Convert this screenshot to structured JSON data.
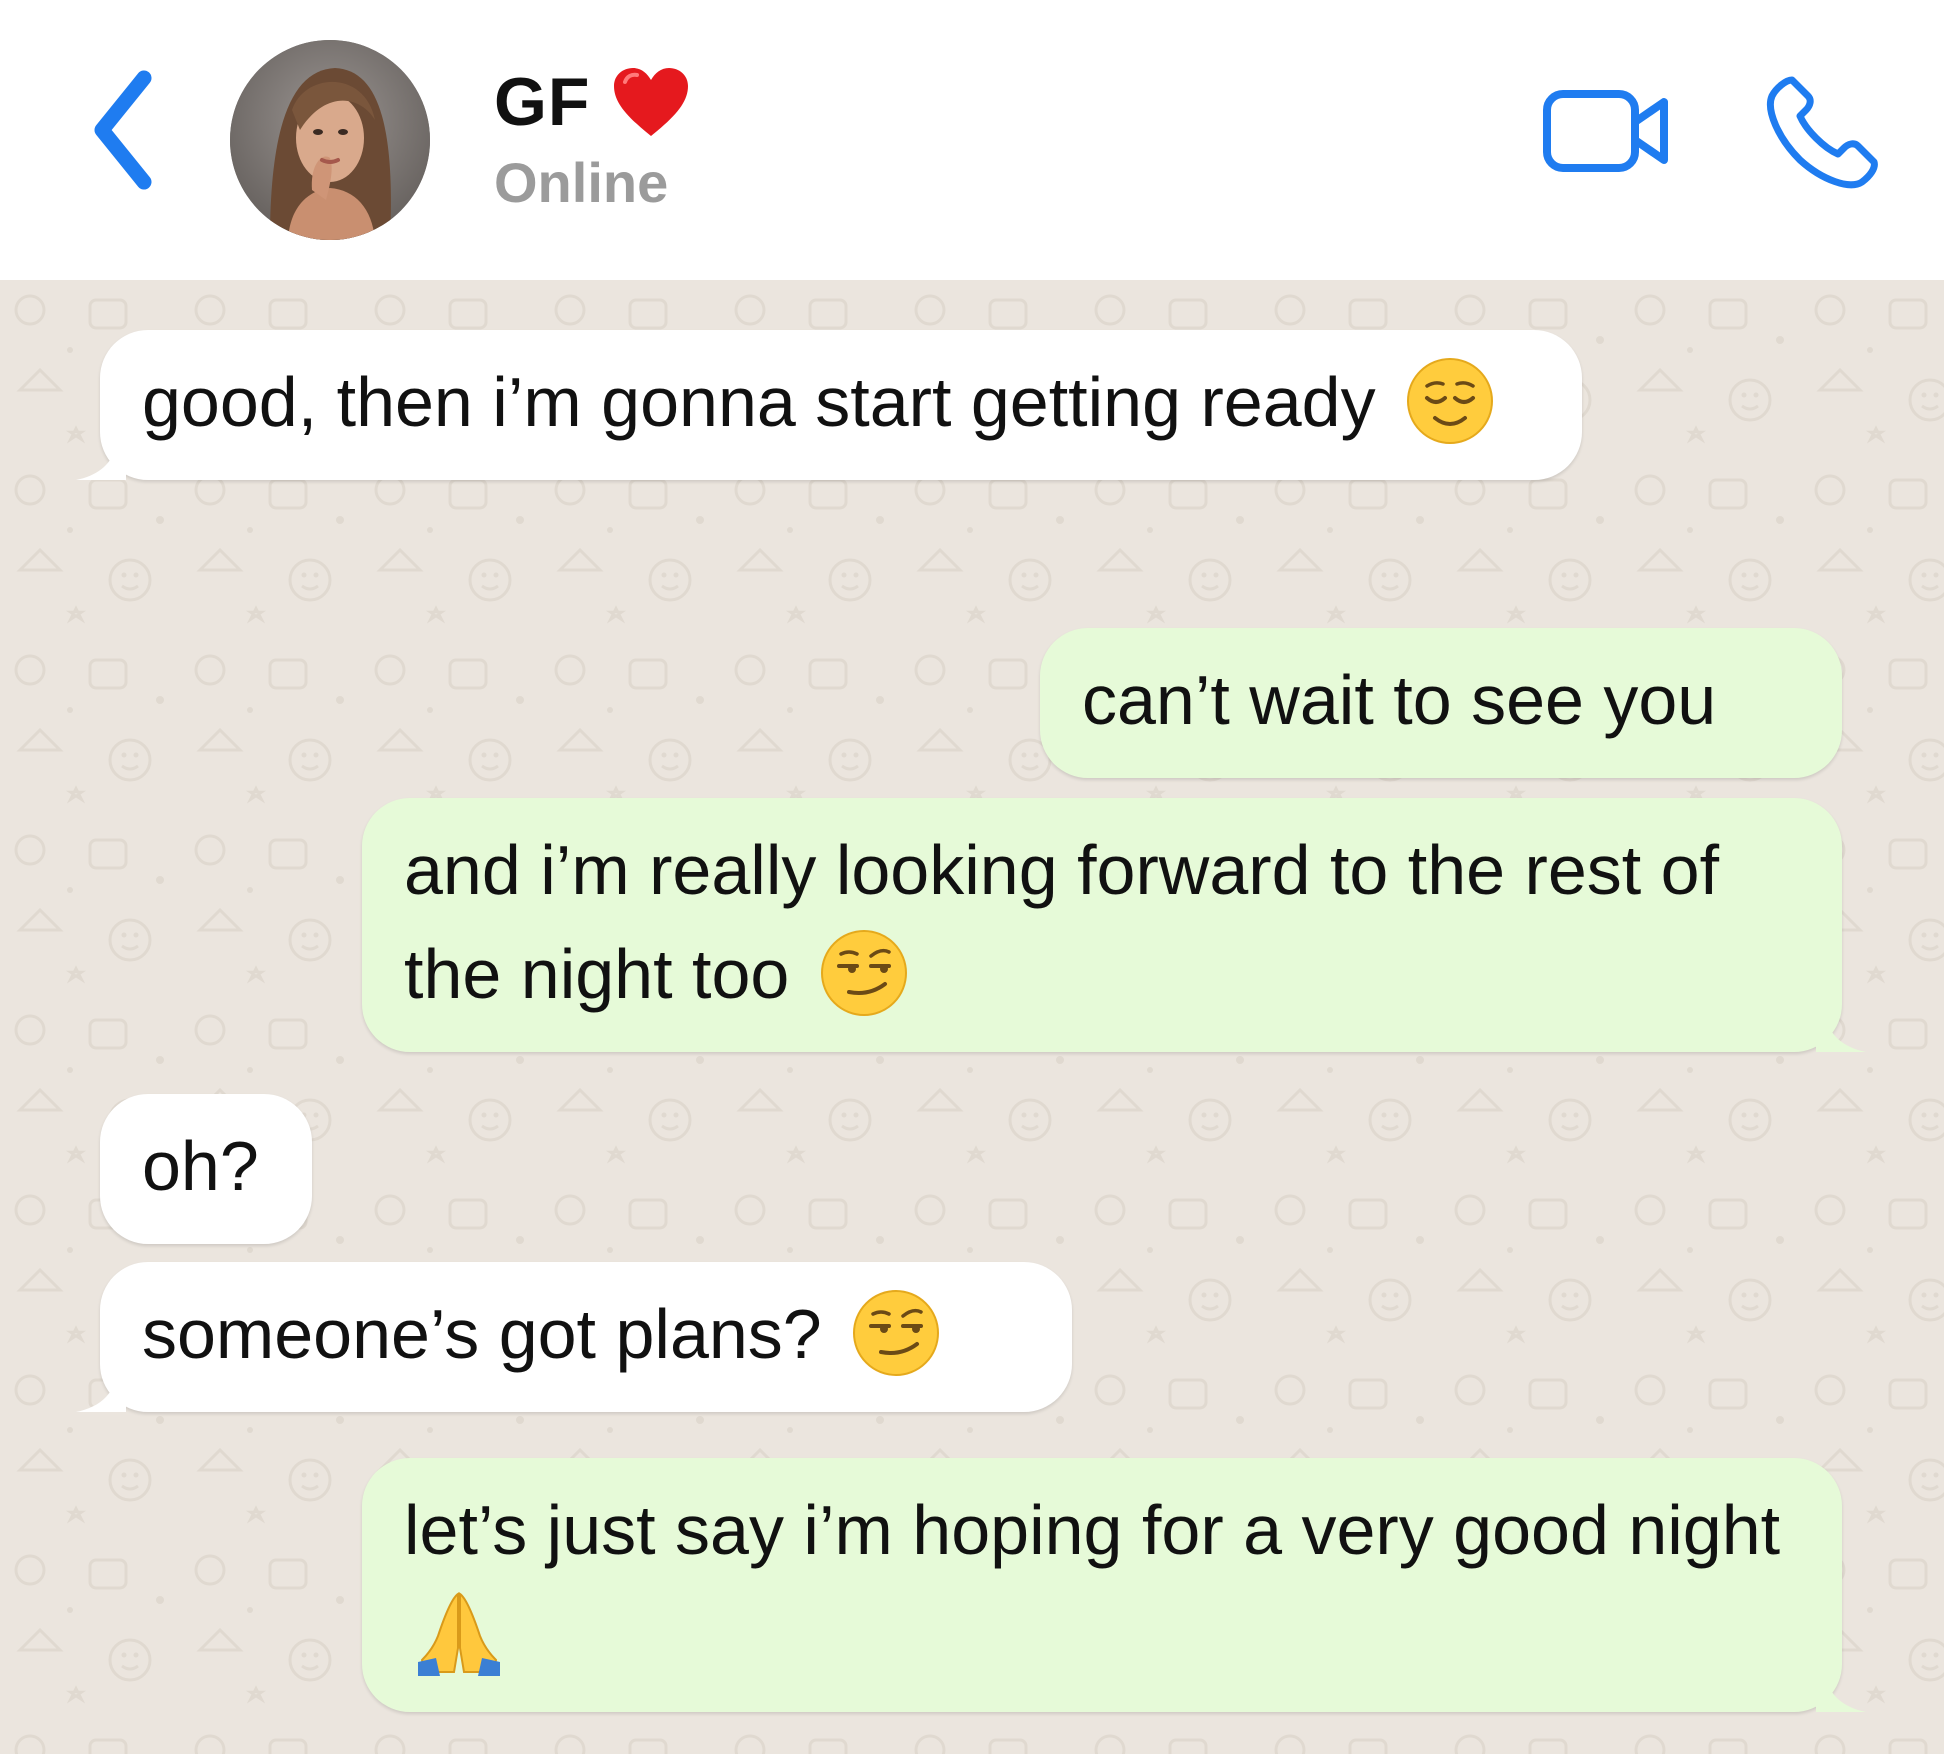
{
  "header": {
    "contact_name": "GF",
    "contact_status": "Online"
  },
  "messages": [
    {
      "direction": "incoming",
      "text": "good, then i’m gonna start getting ready",
      "emoji": "relieved-face"
    },
    {
      "direction": "outgoing",
      "text": "can’t wait to see you"
    },
    {
      "direction": "outgoing",
      "text": "and i’m really looking forward to the rest of the night too",
      "emoji": "smirking-face"
    },
    {
      "direction": "incoming",
      "text": "oh?"
    },
    {
      "direction": "incoming",
      "text": "someone’s got plans?",
      "emoji": "smirking-face"
    },
    {
      "direction": "outgoing",
      "text": "let’s just say i’m hoping for a very good night",
      "emoji": "folded-hands"
    }
  ],
  "colors": {
    "accent": "#1f7cf0",
    "incoming_bubble": "#ffffff",
    "outgoing_bubble": "#e6fad8",
    "chat_background": "#ebe5de",
    "status_text": "#9b9b9b"
  },
  "icons": {
    "back": "chevron-left-icon",
    "video": "video-camera-icon",
    "call": "phone-icon",
    "name_emoji": "red-heart-icon"
  }
}
